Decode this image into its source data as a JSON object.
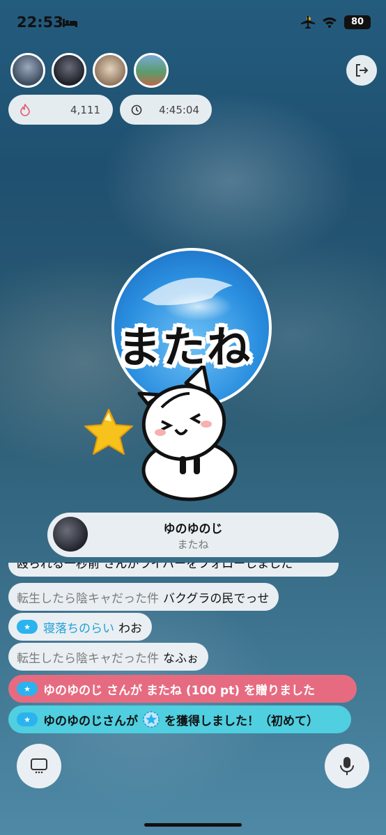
{
  "status_bar": {
    "time": "22:53",
    "battery": "80"
  },
  "viewers": [
    {
      "name": "viewer-1",
      "color": "#5a6b82"
    },
    {
      "name": "viewer-2",
      "color": "#2b2d38"
    },
    {
      "name": "viewer-3",
      "color": "#b79a7c"
    },
    {
      "name": "viewer-4",
      "color": "#3f8a6a"
    }
  ],
  "stats": {
    "points": "4,111",
    "elapsed": "4:45:04"
  },
  "gift_overlay": {
    "text": "またね"
  },
  "gift_banner": {
    "name": "ゆのゆのじ",
    "gift": "またね"
  },
  "chat": {
    "cut_line": "殴られる一秒前 さんがライバーをフォローしました",
    "messages": [
      {
        "who": "転生したら陰キャだった件",
        "text": "バクグラの民でっせ"
      },
      {
        "who": "寝落ちのらい",
        "text": "わお",
        "badge": "★"
      },
      {
        "who": "転生したら陰キャだった件",
        "text": "なふぉ"
      }
    ],
    "gift_message": {
      "badge": "★",
      "name": "ゆのゆのじ",
      "rest": "さんが またね (100 pt) を贈りました"
    },
    "achievement_message": {
      "badge": "★",
      "before": "ゆのゆのじさんが",
      "after": "を獲得しました！（初めて）"
    }
  },
  "colors": {
    "gift_bg": "#e66b81",
    "achievement_bg": "#4fcfe0",
    "badge": "#2ab3ee",
    "highlight_name": "#1e9fd8"
  }
}
